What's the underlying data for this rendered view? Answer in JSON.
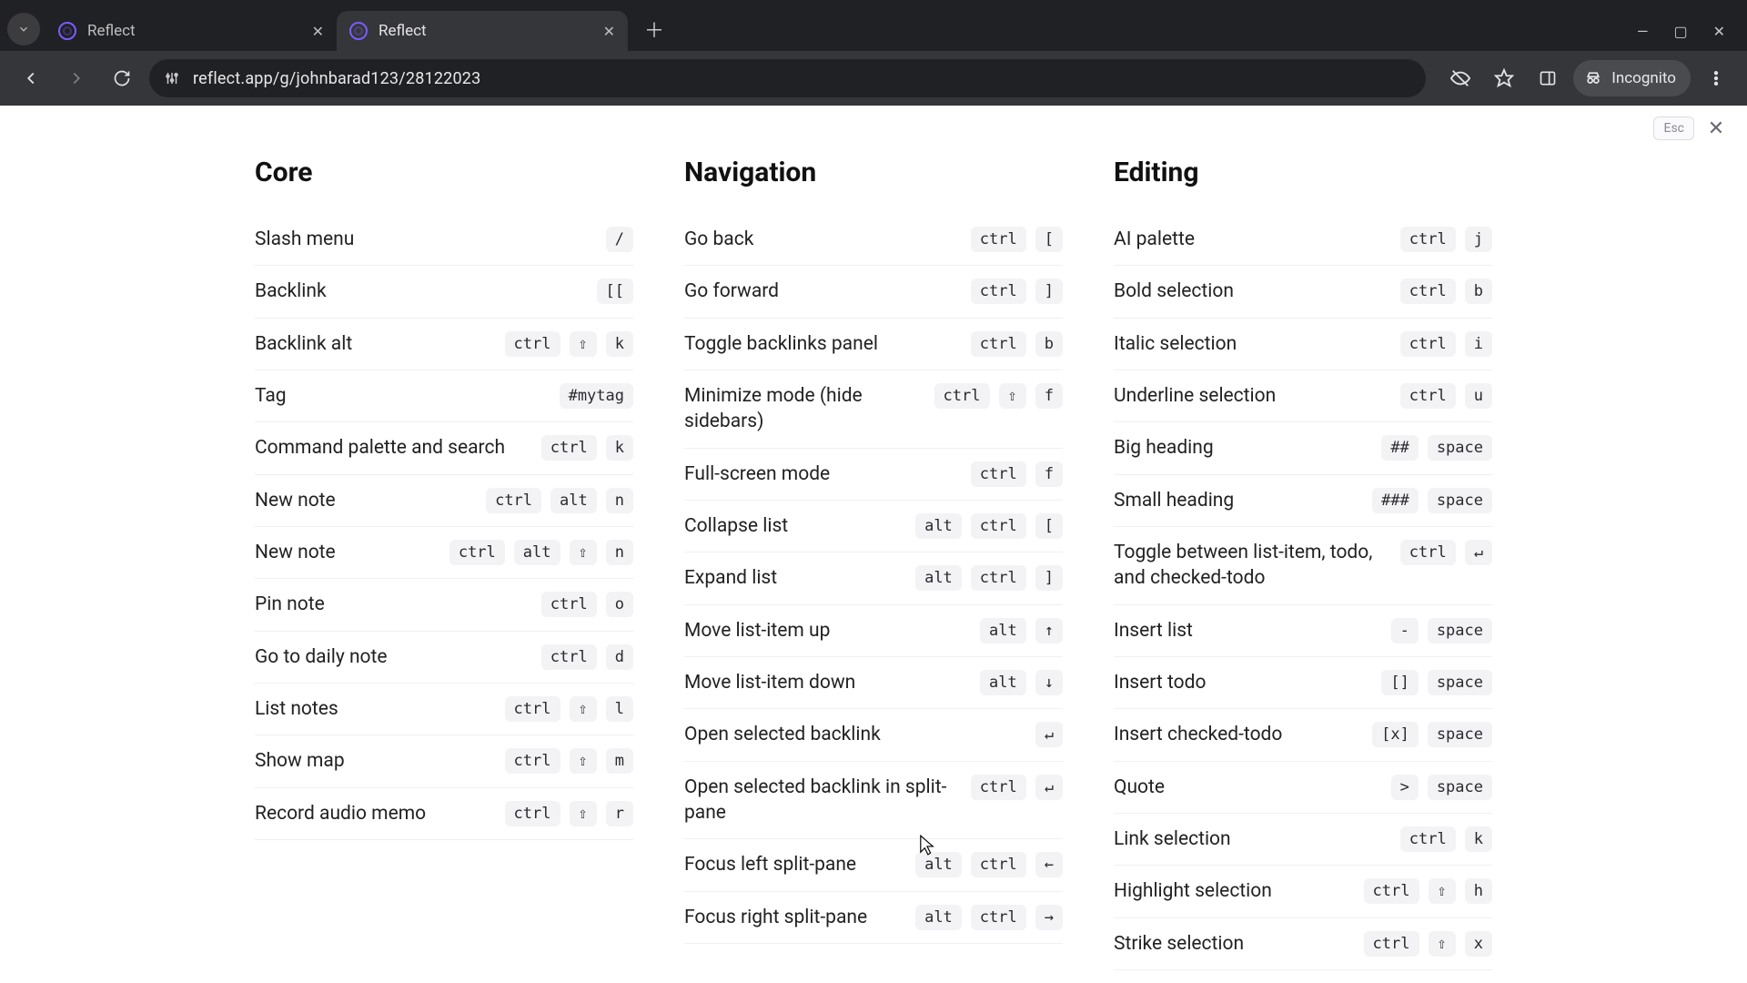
{
  "browser": {
    "tabs": [
      {
        "title": "Reflect",
        "active": false
      },
      {
        "title": "Reflect",
        "active": true
      }
    ],
    "url": "reflect.app/g/johnbarad123/28122023",
    "incognito_label": "Incognito"
  },
  "overlay": {
    "esc_label": "Esc"
  },
  "columns": [
    {
      "title": "Core",
      "items": [
        {
          "label": "Slash menu",
          "keys": [
            "/"
          ]
        },
        {
          "label": "Backlink",
          "keys": [
            "[["
          ]
        },
        {
          "label": "Backlink alt",
          "keys": [
            "ctrl",
            "⇧",
            "k"
          ]
        },
        {
          "label": "Tag",
          "keys": [
            "#mytag"
          ]
        },
        {
          "label": "Command palette and search",
          "keys": [
            "ctrl",
            "k"
          ]
        },
        {
          "label": "New note",
          "keys": [
            "ctrl",
            "alt",
            "n"
          ]
        },
        {
          "label": "New note",
          "keys": [
            "ctrl",
            "alt",
            "⇧",
            "n"
          ]
        },
        {
          "label": "Pin note",
          "keys": [
            "ctrl",
            "o"
          ]
        },
        {
          "label": "Go to daily note",
          "keys": [
            "ctrl",
            "d"
          ]
        },
        {
          "label": "List notes",
          "keys": [
            "ctrl",
            "⇧",
            "l"
          ]
        },
        {
          "label": "Show map",
          "keys": [
            "ctrl",
            "⇧",
            "m"
          ]
        },
        {
          "label": "Record audio memo",
          "keys": [
            "ctrl",
            "⇧",
            "r"
          ]
        }
      ]
    },
    {
      "title": "Navigation",
      "items": [
        {
          "label": "Go back",
          "keys": [
            "ctrl",
            "["
          ]
        },
        {
          "label": "Go forward",
          "keys": [
            "ctrl",
            "]"
          ]
        },
        {
          "label": "Toggle backlinks panel",
          "keys": [
            "ctrl",
            "b"
          ]
        },
        {
          "label": "Minimize mode (hide sidebars)",
          "keys": [
            "ctrl",
            "⇧",
            "f"
          ]
        },
        {
          "label": "Full-screen mode",
          "keys": [
            "ctrl",
            "f"
          ]
        },
        {
          "label": "Collapse list",
          "keys": [
            "alt",
            "ctrl",
            "["
          ]
        },
        {
          "label": "Expand list",
          "keys": [
            "alt",
            "ctrl",
            "]"
          ]
        },
        {
          "label": "Move list-item up",
          "keys": [
            "alt",
            "↑"
          ]
        },
        {
          "label": "Move list-item down",
          "keys": [
            "alt",
            "↓"
          ]
        },
        {
          "label": "Open selected backlink",
          "keys": [
            "↵"
          ]
        },
        {
          "label": "Open selected backlink in split-pane",
          "keys": [
            "ctrl",
            "↵"
          ]
        },
        {
          "label": "Focus left split-pane",
          "keys": [
            "alt",
            "ctrl",
            "←"
          ]
        },
        {
          "label": "Focus right split-pane",
          "keys": [
            "alt",
            "ctrl",
            "→"
          ]
        }
      ]
    },
    {
      "title": "Editing",
      "items": [
        {
          "label": "AI palette",
          "keys": [
            "ctrl",
            "j"
          ]
        },
        {
          "label": "Bold selection",
          "keys": [
            "ctrl",
            "b"
          ]
        },
        {
          "label": "Italic selection",
          "keys": [
            "ctrl",
            "i"
          ]
        },
        {
          "label": "Underline selection",
          "keys": [
            "ctrl",
            "u"
          ]
        },
        {
          "label": "Big heading",
          "keys": [
            "##",
            "space"
          ]
        },
        {
          "label": "Small heading",
          "keys": [
            "###",
            "space"
          ]
        },
        {
          "label": "Toggle between list-item, todo, and checked-todo",
          "keys": [
            "ctrl",
            "↵"
          ]
        },
        {
          "label": "Insert list",
          "keys": [
            "-",
            "space"
          ]
        },
        {
          "label": "Insert todo",
          "keys": [
            "[]",
            "space"
          ]
        },
        {
          "label": "Insert checked-todo",
          "keys": [
            "[x]",
            "space"
          ]
        },
        {
          "label": "Quote",
          "keys": [
            ">",
            "space"
          ]
        },
        {
          "label": "Link selection",
          "keys": [
            "ctrl",
            "k"
          ]
        },
        {
          "label": "Highlight selection",
          "keys": [
            "ctrl",
            "⇧",
            "h"
          ]
        },
        {
          "label": "Strike selection",
          "keys": [
            "ctrl",
            "⇧",
            "x"
          ]
        }
      ]
    }
  ]
}
